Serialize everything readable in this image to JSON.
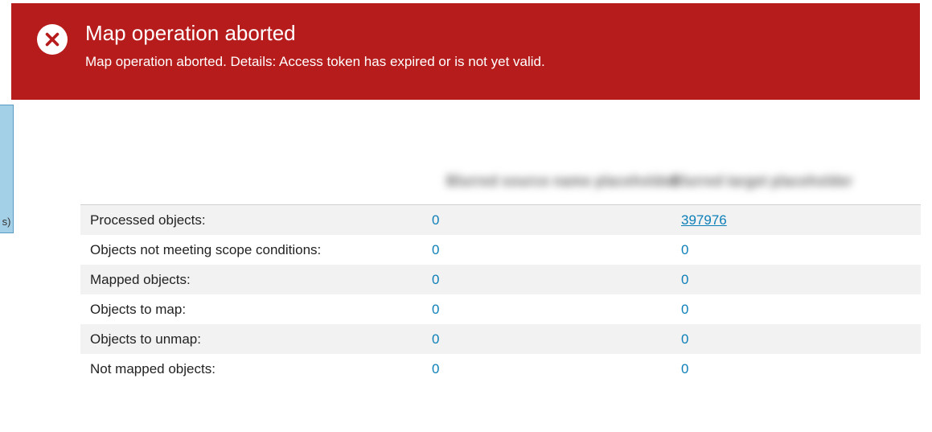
{
  "error": {
    "title": "Map operation aborted",
    "message": "Map operation aborted. Details: Access token has expired or is not yet valid."
  },
  "left_sliver_text": "s)",
  "table": {
    "header": {
      "col_a": "Blurred source name placeholder",
      "col_b": "Blurred target placeholder"
    },
    "rows": [
      {
        "label": "Processed objects:",
        "a": "0",
        "b": "397976",
        "b_link": true
      },
      {
        "label": "Objects not meeting scope conditions:",
        "a": "0",
        "b": "0"
      },
      {
        "label": "Mapped objects:",
        "a": "0",
        "b": "0"
      },
      {
        "label": "Objects to map:",
        "a": "0",
        "b": "0"
      },
      {
        "label": "Objects to unmap:",
        "a": "0",
        "b": "0"
      },
      {
        "label": "Not mapped objects:",
        "a": "0",
        "b": "0"
      }
    ]
  }
}
